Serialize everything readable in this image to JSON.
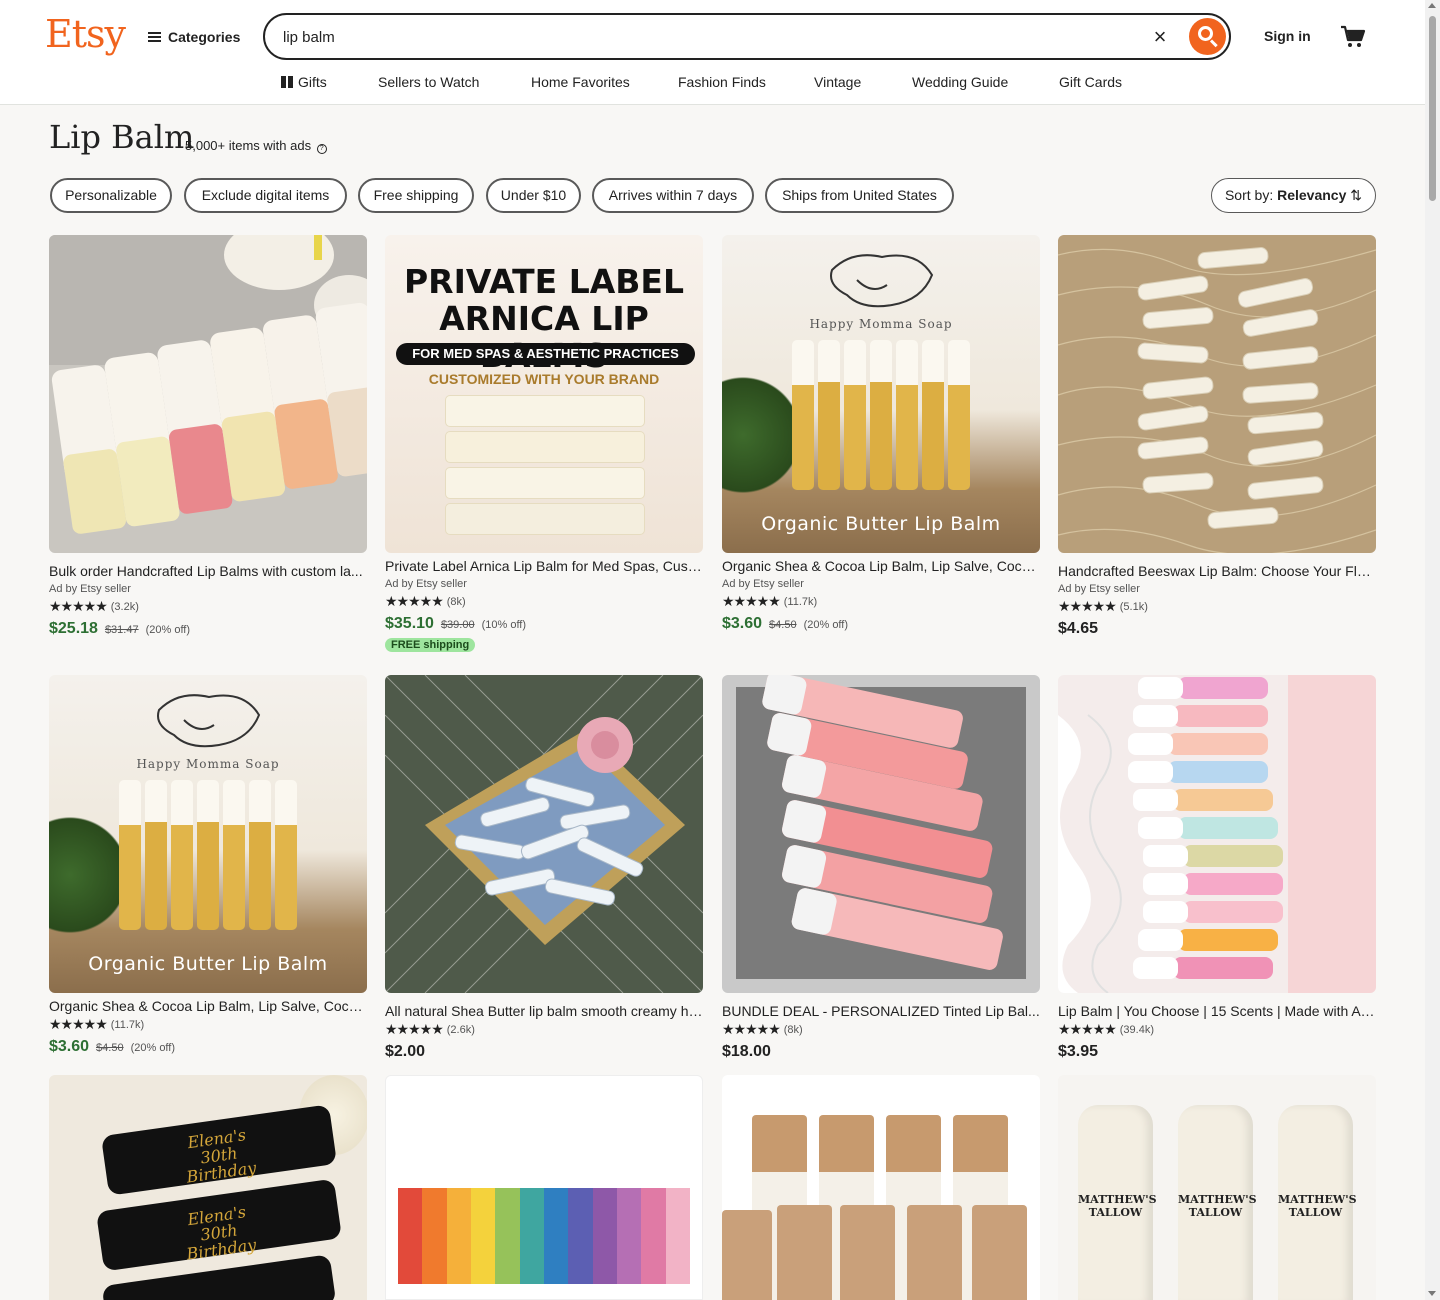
{
  "header": {
    "logo": "Etsy",
    "categories_label": "Categories",
    "search_value": "lip balm",
    "clear_glyph": "×",
    "sign_in": "Sign in",
    "subnav": [
      "Gifts",
      "Sellers to Watch",
      "Home Favorites",
      "Fashion Finds",
      "Vintage",
      "Wedding Guide",
      "Gift Cards"
    ]
  },
  "results": {
    "title": "Lip Balm",
    "count": "5,000+ items with ads",
    "info_glyph": "?",
    "sort_label": "Sort by:",
    "sort_value": "Relevancy",
    "sort_glyph": "⇅"
  },
  "filters": [
    "Personalizable",
    "Exclude digital items",
    "Free shipping",
    "Under $10",
    "Arrives within 7 days",
    "Ships from United States"
  ],
  "listings": [
    {
      "title": "Bulk order Handcrafted Lip Balms with custom la...",
      "ad": "Ad by Etsy seller",
      "stars": "★★★★★",
      "reviews": "(3.2k)",
      "price": "$25.18",
      "original": "$31.47",
      "discount": "(20% off)"
    },
    {
      "title": "Private Label Arnica Lip Balm for Med Spas, Cust...",
      "ad": "Ad by Etsy seller",
      "stars": "★★★★★",
      "reviews": "(8k)",
      "price": "$35.10",
      "original": "$39.00",
      "discount": "(10% off)",
      "badge": "FREE shipping"
    },
    {
      "title": "Organic Shea & Cocoa Lip Balm, Lip Salve, Cocon...",
      "ad": "Ad by Etsy seller",
      "stars": "★★★★★",
      "reviews": "(11.7k)",
      "price": "$3.60",
      "original": "$4.50",
      "discount": "(20% off)"
    },
    {
      "title": "Handcrafted Beeswax Lip Balm: Choose Your Flav...",
      "ad": "Ad by Etsy seller",
      "stars": "★★★★★",
      "reviews": "(5.1k)",
      "price": "$4.65"
    },
    {
      "title": "Organic Shea & Cocoa Lip Balm, Lip Salve, Cocon...",
      "stars": "★★★★★",
      "reviews": "(11.7k)",
      "price": "$3.60",
      "original": "$4.50",
      "discount": "(20% off)"
    },
    {
      "title": "All natural Shea Butter lip balm smooth creamy he...",
      "stars": "★★★★★",
      "reviews": "(2.6k)",
      "price": "$2.00"
    },
    {
      "title": "BUNDLE DEAL - PERSONALIZED Tinted Lip Bal...",
      "stars": "★★★★★",
      "reviews": "(8k)",
      "price": "$18.00"
    },
    {
      "title": "Lip Balm | You Choose | 15 Scents | Made with Av...",
      "stars": "★★★★★",
      "reviews": "(39.4k)",
      "price": "$3.95"
    }
  ],
  "image_text": {
    "private_label_line1": "PRIVATE LABEL",
    "private_label_line2": "ARNICA LIP BALMS",
    "private_label_banner": "FOR MED SPAS & AESTHETIC PRACTICES",
    "private_label_sub": "CUSTOMIZED WITH YOUR BRAND",
    "happy_momma": "Happy Momma Soap",
    "organic_butter": "Organic Butter Lip Balm",
    "elena": "Elena's 30th Birthday",
    "matthews": "MATTHEW'S TALLOW"
  },
  "colors": {
    "accent": "#f1641e",
    "sale": "#2d6f33",
    "free_shipping_bg": "#9ee59e"
  }
}
